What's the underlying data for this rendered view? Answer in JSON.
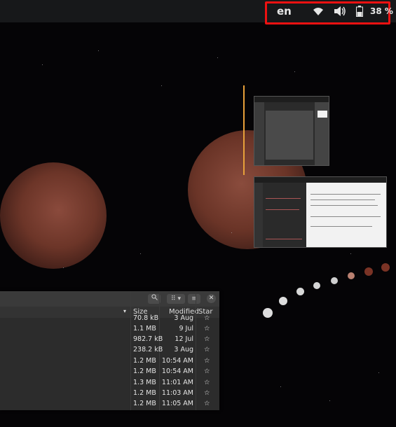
{
  "topbar": {
    "language": "en",
    "wifi_icon": "wifi-icon",
    "volume_icon": "volume-icon",
    "battery_icon": "battery-icon",
    "battery_percent": "38 %",
    "highlight_color": "#ee1111"
  },
  "file_manager": {
    "columns": {
      "size": "Size",
      "modified": "Modified",
      "star": "Star"
    },
    "rows": [
      {
        "size": "70.8 kB",
        "modified": "3 Aug",
        "star": "☆"
      },
      {
        "size": "1.1 MB",
        "modified": "9 Jul",
        "star": "☆"
      },
      {
        "size": "982.7 kB",
        "modified": "12 Jul",
        "star": "☆"
      },
      {
        "size": "238.2 kB",
        "modified": "3 Aug",
        "star": "☆"
      },
      {
        "size": "1.2 MB",
        "modified": "10:54 AM",
        "star": "☆"
      },
      {
        "size": "1.2 MB",
        "modified": "10:54 AM",
        "star": "☆"
      },
      {
        "size": "1.3 MB",
        "modified": "11:01 AM",
        "star": "☆"
      },
      {
        "size": "1.2 MB",
        "modified": "11:03 AM",
        "star": "☆"
      },
      {
        "size": "1.2 MB",
        "modified": "11:05 AM",
        "star": "☆"
      }
    ]
  },
  "window_switcher": {
    "accent": "#e8a13a"
  }
}
